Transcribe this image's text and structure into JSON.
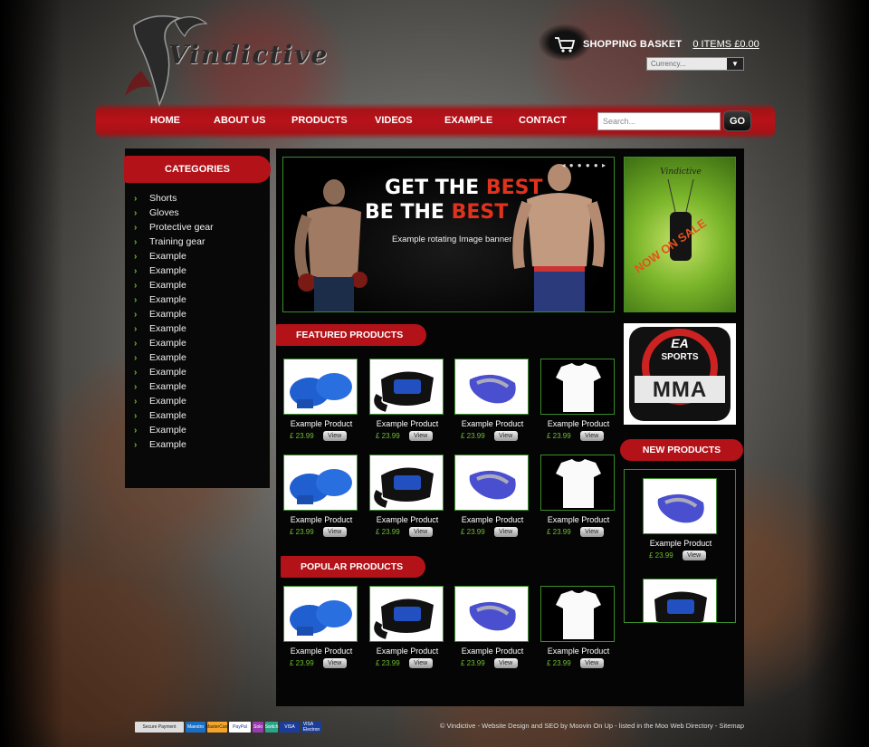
{
  "header": {
    "logo_text": "Vindictive",
    "basket_label": "SHOPPING BASKET",
    "basket_count": "0 ITEMS  £0.00",
    "currency_placeholder": "Currency..."
  },
  "nav": {
    "items": [
      "HOME",
      "ABOUT US",
      "PRODUCTS",
      "VIDEOS",
      "EXAMPLE",
      "CONTACT"
    ],
    "search_placeholder": "Search...",
    "search_button": "GO"
  },
  "sidebar": {
    "title": "CATEGORIES",
    "items": [
      "Shorts",
      "Gloves",
      "Protective gear",
      "Training gear",
      "Example",
      "Example",
      "Example",
      "Example",
      "Example",
      "Example",
      "Example",
      "Example",
      "Example",
      "Example",
      "Example",
      "Example",
      "Example",
      "Example"
    ]
  },
  "banner": {
    "line1_a": "GET THE ",
    "line1_b": "BEST",
    "line2_a": "BE THE ",
    "line2_b": "BEST",
    "caption": "Example rotating Image banner",
    "dots": "◂ ● ● ● ● ▸"
  },
  "featured": {
    "title": "FEATURED PRODUCTS",
    "products": [
      {
        "name": "Example Product",
        "price": "£ 23.99",
        "view": "View",
        "icon": "boxing-gloves-icon"
      },
      {
        "name": "Example Product",
        "price": "£ 23.99",
        "view": "View",
        "icon": "mma-gloves-icon"
      },
      {
        "name": "Example Product",
        "price": "£ 23.99",
        "view": "View",
        "icon": "mouthguard-icon"
      },
      {
        "name": "Example Product",
        "price": "£ 23.99",
        "view": "View",
        "icon": "tshirt-icon"
      },
      {
        "name": "Example Product",
        "price": "£ 23.99",
        "view": "View",
        "icon": "boxing-gloves-icon"
      },
      {
        "name": "Example Product",
        "price": "£ 23.99",
        "view": "View",
        "icon": "mma-gloves-icon"
      },
      {
        "name": "Example Product",
        "price": "£ 23.99",
        "view": "View",
        "icon": "mouthguard-icon"
      },
      {
        "name": "Example Product",
        "price": "£ 23.99",
        "view": "View",
        "icon": "tshirt-icon"
      }
    ]
  },
  "popular": {
    "title": "POPULAR PRODUCTS",
    "products": [
      {
        "name": "Example Product",
        "price": "£ 23.99",
        "view": "View",
        "icon": "boxing-gloves-icon"
      },
      {
        "name": "Example Product",
        "price": "£ 23.99",
        "view": "View",
        "icon": "mma-gloves-icon"
      },
      {
        "name": "Example Product",
        "price": "£ 23.99",
        "view": "View",
        "icon": "mouthguard-icon"
      },
      {
        "name": "Example Product",
        "price": "£ 23.99",
        "view": "View",
        "icon": "tshirt-icon"
      }
    ]
  },
  "ads": {
    "sale_text": "NOW ON SALE",
    "ad2_line1": "EA",
    "ad2_line2": "SPORTS",
    "ad2_line3": "MMA"
  },
  "new_products": {
    "title": "NEW PRODUCTS",
    "products": [
      {
        "name": "Example Product",
        "price": "£ 23.99",
        "view": "View",
        "icon": "mouthguard-icon"
      }
    ]
  },
  "footer": {
    "text": "© Vindictive - Website Design and SEO by Moovin On Up - listed in the Moo Web Directory - Sitemap",
    "payments": [
      "Secure Payment",
      "Maestro",
      "MasterCard",
      "PayPal",
      "Solo",
      "Switch",
      "VISA",
      "VISA Electron"
    ]
  },
  "colors": {
    "accent_red": "#b31219",
    "price_green": "#6fbf2e",
    "border_green": "#3b8d2a"
  }
}
